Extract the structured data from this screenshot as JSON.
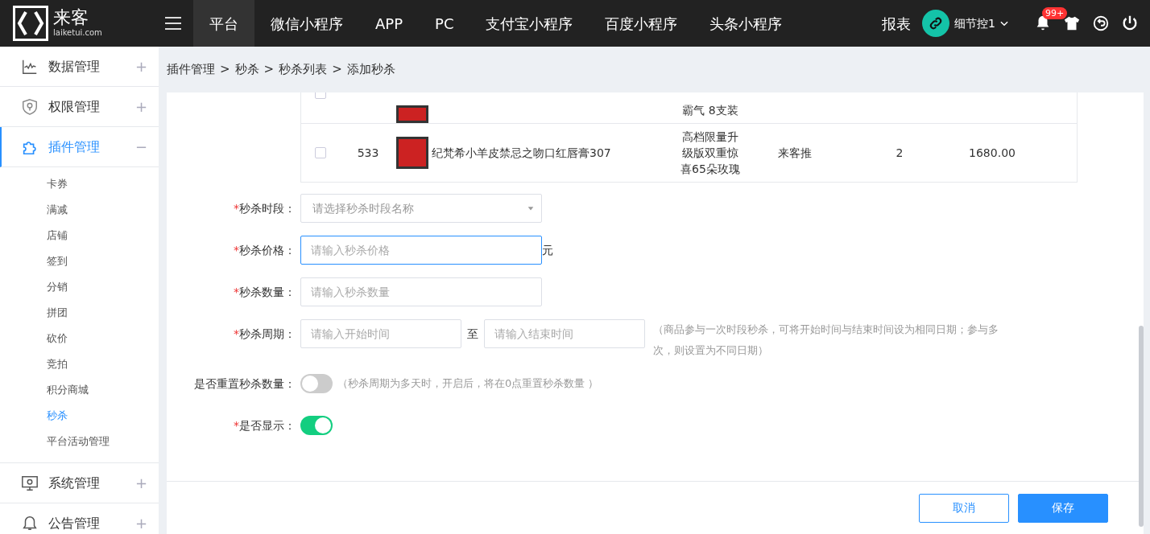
{
  "header": {
    "logo": {
      "name": "来客",
      "domain": "laiketui.com"
    },
    "nav": [
      {
        "label": "平台",
        "selected": true
      },
      {
        "label": "微信小程序",
        "selected": false
      },
      {
        "label": "APP",
        "selected": false
      },
      {
        "label": "PC",
        "selected": false
      },
      {
        "label": "支付宝小程序",
        "selected": false
      },
      {
        "label": "百度小程序",
        "selected": false
      },
      {
        "label": "头条小程序",
        "selected": false
      }
    ],
    "report": "报表",
    "user": "细节控1",
    "notification_badge": "99+"
  },
  "sidebar": {
    "items": [
      {
        "kind": "chart",
        "label": "数据管理",
        "expanded": false,
        "toggle": "+"
      },
      {
        "kind": "shield",
        "label": "权限管理",
        "expanded": false,
        "toggle": "+"
      },
      {
        "kind": "puzzle",
        "label": "插件管理",
        "expanded": true,
        "toggle": "−",
        "children": [
          {
            "label": "卡券",
            "selected": false
          },
          {
            "label": "满减",
            "selected": false
          },
          {
            "label": "店铺",
            "selected": false
          },
          {
            "label": "签到",
            "selected": false
          },
          {
            "label": "分销",
            "selected": false
          },
          {
            "label": "拼团",
            "selected": false
          },
          {
            "label": "砍价",
            "selected": false
          },
          {
            "label": "竞拍",
            "selected": false
          },
          {
            "label": "积分商城",
            "selected": false
          },
          {
            "label": "秒杀",
            "selected": true
          },
          {
            "label": "平台活动管理",
            "selected": false
          }
        ]
      },
      {
        "kind": "monitor",
        "label": "系统管理",
        "expanded": false,
        "toggle": "+"
      },
      {
        "kind": "bell",
        "label": "公告管理",
        "expanded": false,
        "toggle": "+"
      }
    ]
  },
  "breadcrumb": {
    "separator": ">",
    "items": [
      "插件管理",
      "秒杀",
      "秒杀列表",
      "添加秒杀"
    ]
  },
  "table": {
    "rows": [
      {
        "partial": true,
        "checked": false,
        "spec": "霸气 8支装"
      },
      {
        "partial": false,
        "checked": false,
        "id": "533",
        "name": "纪梵希小羊皮禁忌之吻口红唇膏307",
        "spec": "高档限量升级版双重惊喜65朵玫瑰",
        "source": "来客推",
        "stock": "2",
        "price": "1680.00"
      }
    ]
  },
  "required_mark": "*",
  "fields": [
    {
      "kind": "select",
      "required": true,
      "label": "秒杀时段：",
      "placeholder": "请选择秒杀时段名称"
    },
    {
      "kind": "input",
      "required": true,
      "label": "秒杀价格：",
      "placeholder": "请输入秒杀价格",
      "focused": true,
      "unit": "元"
    },
    {
      "kind": "input",
      "required": true,
      "label": "秒杀数量：",
      "placeholder": "请输入秒杀数量",
      "focused": false
    },
    {
      "kind": "range",
      "required": true,
      "label": "秒杀周期：",
      "start_placeholder": "请输入开始时间",
      "separator": "至",
      "end_placeholder": "请输入结束时间",
      "hint": "（商品参与一次时段秒杀，可将开始时间与结束时间设为相同日期；参与多次，则设置为不同日期）"
    },
    {
      "kind": "switch",
      "required": false,
      "label": "是否重置秒杀数量：",
      "on": false,
      "hint": "（秒杀周期为多天时，开启后，将在0点重置秒杀数量 ）"
    },
    {
      "kind": "switch",
      "required": true,
      "label": "是否显示：",
      "on": true
    }
  ],
  "buttons": {
    "cancel": "取消",
    "save": "保存"
  }
}
